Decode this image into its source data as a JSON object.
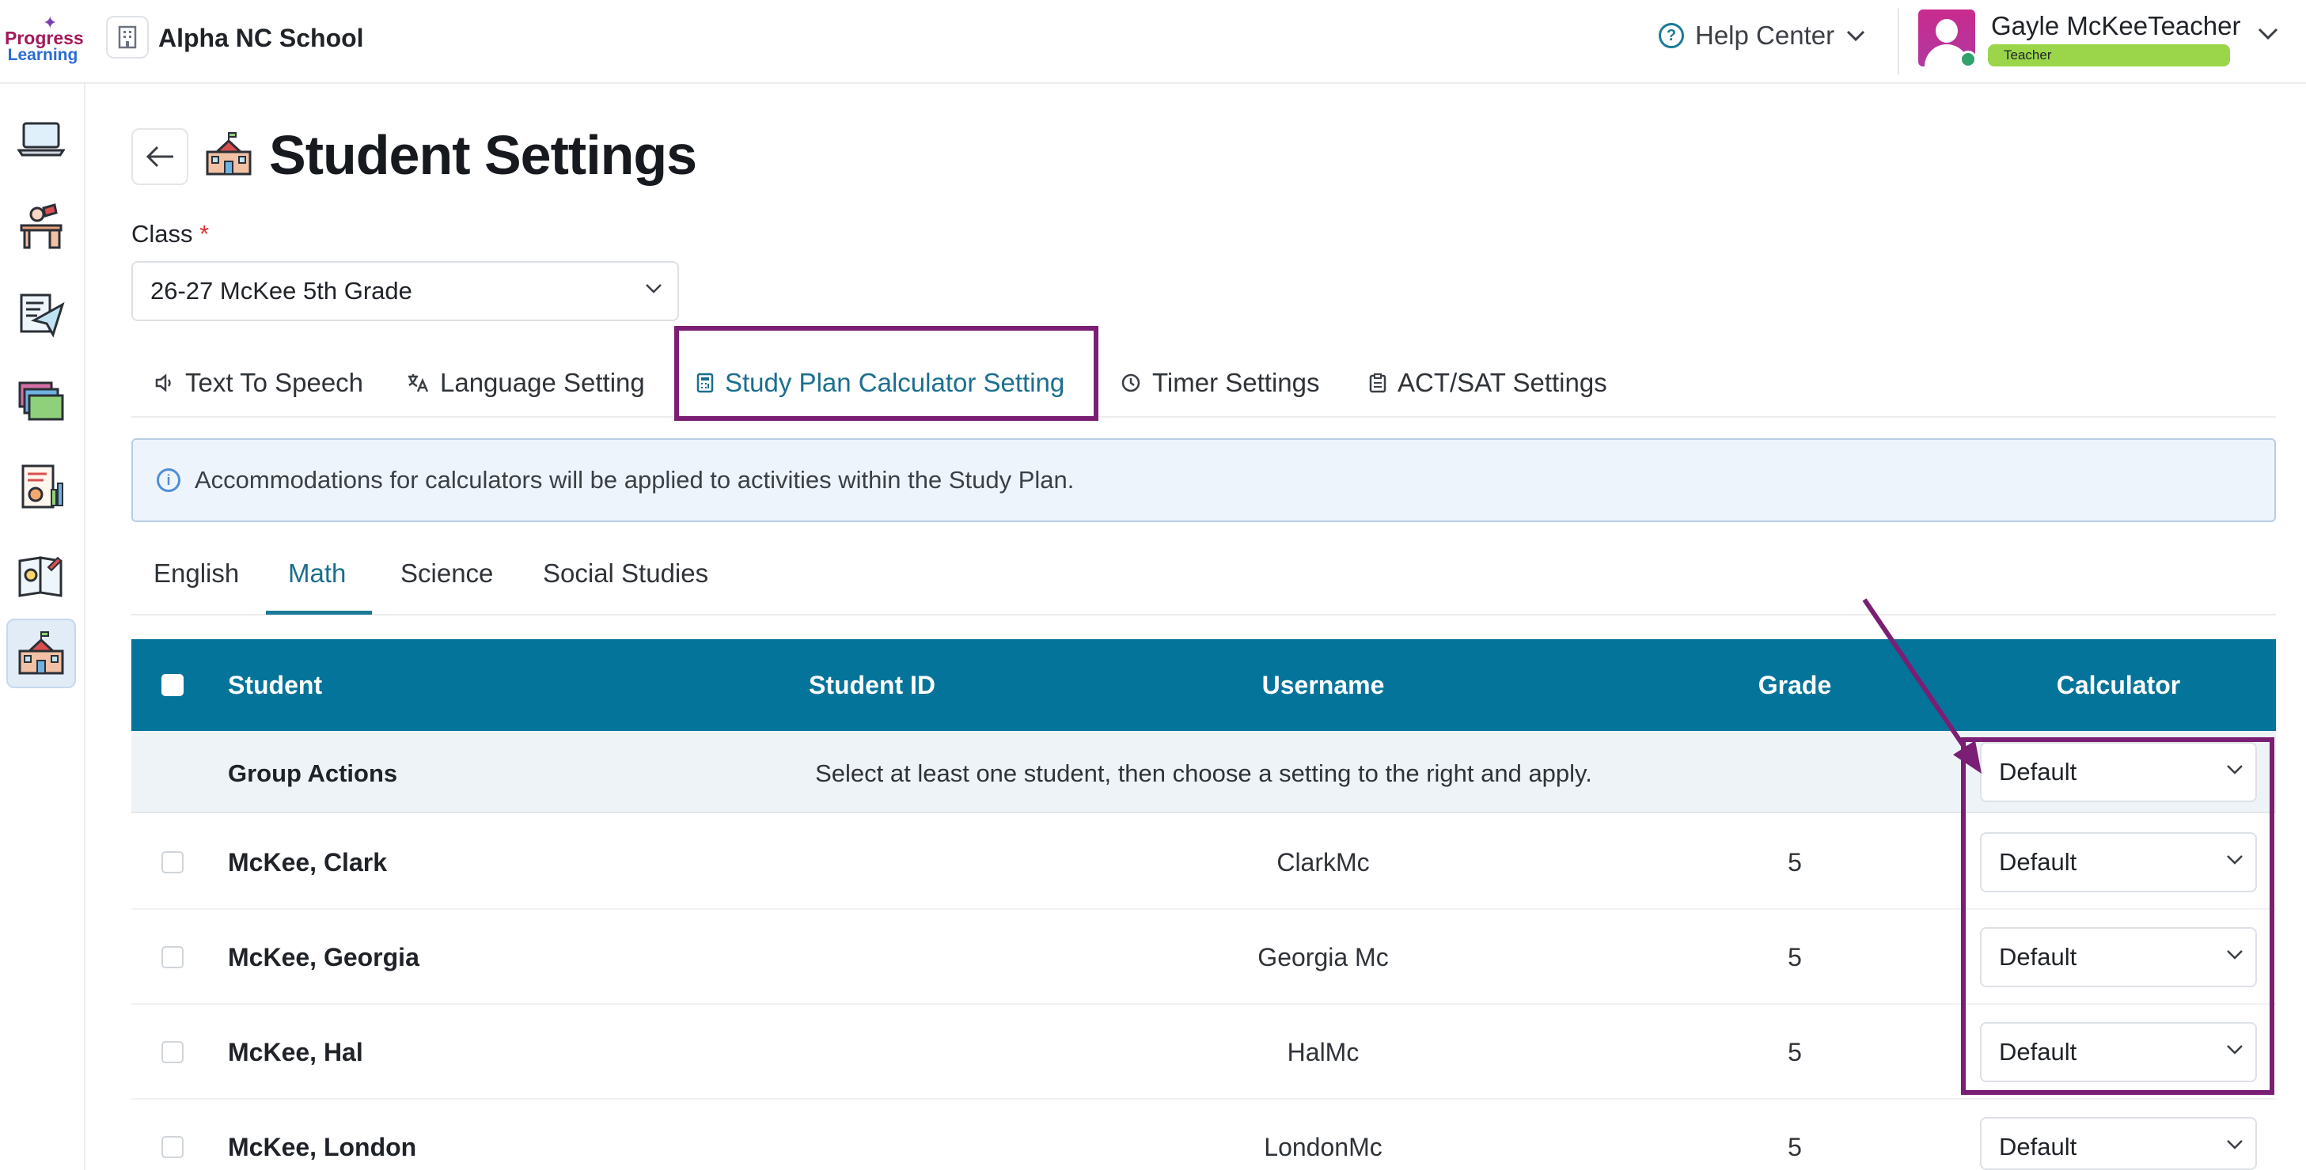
{
  "header": {
    "logo_line1": "Progress",
    "logo_line2": "Learning",
    "school_name": "Alpha NC School",
    "help_label": "Help Center",
    "user_name": "Gayle McKeeTeacher",
    "user_role": "Teacher"
  },
  "rail": {
    "icons": [
      "laptop-icon",
      "teacher-desk-icon",
      "assignment-send-icon",
      "folders-icon",
      "reports-icon",
      "lesson-plan-icon",
      "school-building-icon"
    ],
    "active_index": 6
  },
  "page": {
    "title": "Student Settings",
    "class_label": "Class",
    "required_mark": "*",
    "class_value": "26-27 McKee 5th Grade"
  },
  "tabs": [
    {
      "label": "Text To Speech",
      "icon": "speaker-icon"
    },
    {
      "label": "Language Setting",
      "icon": "translate-icon"
    },
    {
      "label": "Study Plan Calculator Setting",
      "icon": "calculator-icon",
      "selected": true
    },
    {
      "label": "Timer Settings",
      "icon": "clock-icon"
    },
    {
      "label": "ACT/SAT Settings",
      "icon": "clipboard-icon"
    }
  ],
  "info_message": "Accommodations for calculators will be applied to activities within the Study Plan.",
  "subject_tabs": [
    {
      "label": "English"
    },
    {
      "label": "Math",
      "selected": true
    },
    {
      "label": "Science"
    },
    {
      "label": "Social Studies"
    }
  ],
  "table": {
    "headers": {
      "student": "Student",
      "student_id": "Student ID",
      "username": "Username",
      "grade": "Grade",
      "calculator": "Calculator"
    },
    "group_actions": {
      "label": "Group Actions",
      "message": "Select at least one student, then choose a setting to the right and apply.",
      "value": "Default"
    },
    "rows": [
      {
        "name": "McKee, Clark",
        "username": "ClarkMc",
        "grade": "5",
        "calculator": "Default"
      },
      {
        "name": "McKee, Georgia",
        "username": "Georgia Mc",
        "grade": "5",
        "calculator": "Default"
      },
      {
        "name": "McKee, Hal",
        "username": "HalMc",
        "grade": "5",
        "calculator": "Default"
      },
      {
        "name": "McKee, London",
        "username": "LondonMc",
        "grade": "5",
        "calculator": "Default"
      }
    ]
  },
  "colors": {
    "header_bg": "#05749a",
    "accent": "#1a6f8e",
    "highlight": "#7a1f74",
    "role_badge": "#9bd64a"
  }
}
